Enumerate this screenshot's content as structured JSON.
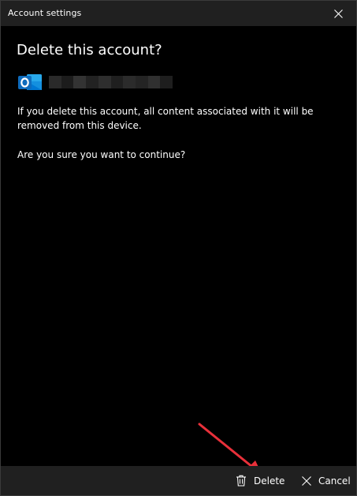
{
  "window": {
    "title": "Account settings"
  },
  "dialog": {
    "heading": "Delete this account?",
    "message": "If you delete this account, all content associated with it will be removed from this device.",
    "question": "Are you sure you want to continue?"
  },
  "account": {
    "icon": "outlook-icon"
  },
  "footer": {
    "delete_label": "Delete",
    "cancel_label": "Cancel"
  },
  "colors": {
    "background": "#000000",
    "bar": "#202020",
    "outlook_blue": "#0f6cbd",
    "annotation_arrow": "#e8303a"
  }
}
